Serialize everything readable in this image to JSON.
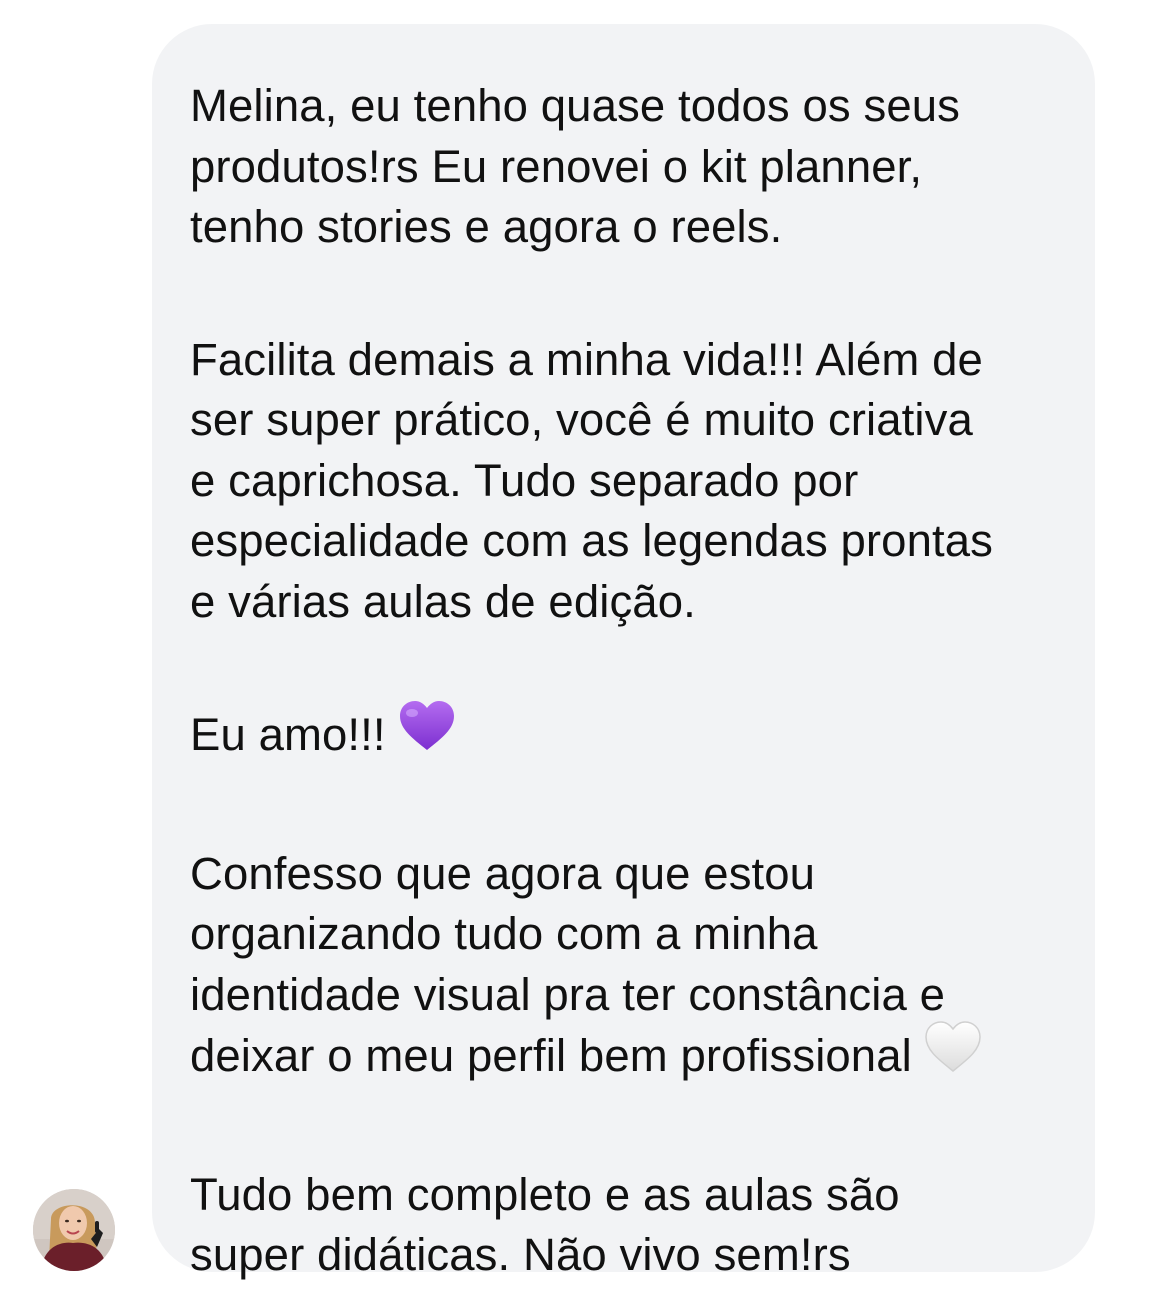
{
  "message": {
    "paragraph_1": "Melina, eu tenho quase todos os seus\nprodutos!rs Eu renovei o kit planner,\ntenho stories e  agora o reels.",
    "paragraph_2": "Facilita demais a minha vida!!! Além de\nser super prático, você é muito criativa\ne caprichosa. Tudo separado por\nespecialidade com as legendas prontas\ne várias aulas de edição.",
    "paragraph_3": "Eu amo!!!",
    "paragraph_3_emoji": "purple-heart-icon",
    "paragraph_4": "Confesso que agora que estou\norganizando tudo com a minha\nidentidade visual pra ter constância e\ndeixar o meu perfil bem profissional",
    "paragraph_4_emoji": "white-heart-icon",
    "paragraph_5": "Tudo bem completo e as aulas são\nsuper didáticas. Não vivo sem!rs"
  },
  "colors": {
    "bubble_background": "#f2f3f5",
    "text": "#111111",
    "purple_heart": "#9b4dde",
    "white_heart": "#f4f4f4"
  },
  "sender": {
    "avatar": "sender-avatar"
  }
}
